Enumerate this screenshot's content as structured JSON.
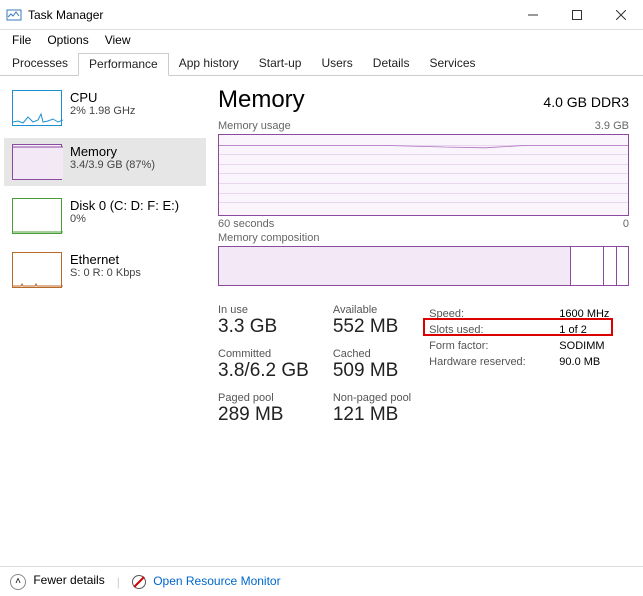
{
  "window": {
    "title": "Task Manager"
  },
  "menu": {
    "file": "File",
    "options": "Options",
    "view": "View"
  },
  "tabs": {
    "processes": "Processes",
    "performance": "Performance",
    "apphistory": "App history",
    "startup": "Start-up",
    "users": "Users",
    "details": "Details",
    "services": "Services"
  },
  "sidebar": {
    "cpu": {
      "label": "CPU",
      "sub": "2% 1.98 GHz",
      "color": "#1e90d2"
    },
    "memory": {
      "label": "Memory",
      "sub": "3.4/3.9 GB (87%)",
      "color": "#8a4a9e"
    },
    "disk": {
      "label": "Disk 0 (C: D: F: E:)",
      "sub": "0%",
      "color": "#4a9e3a"
    },
    "ethernet": {
      "label": "Ethernet",
      "sub": "S: 0 R: 0 Kbps",
      "color": "#b86a2a"
    }
  },
  "main": {
    "title": "Memory",
    "right_label": "4.0 GB DDR3",
    "usage_label": "Memory usage",
    "usage_max": "3.9 GB",
    "axis_left": "60 seconds",
    "axis_right": "0",
    "comp_label": "Memory composition"
  },
  "stats": {
    "inuse": {
      "label": "In use",
      "value": "3.3 GB"
    },
    "available": {
      "label": "Available",
      "value": "552 MB"
    },
    "committed": {
      "label": "Committed",
      "value": "3.8/6.2 GB"
    },
    "cached": {
      "label": "Cached",
      "value": "509 MB"
    },
    "paged": {
      "label": "Paged pool",
      "value": "289 MB"
    },
    "nonpaged": {
      "label": "Non-paged pool",
      "value": "121 MB"
    }
  },
  "details": {
    "speed": {
      "label": "Speed:",
      "value": "1600 MHz"
    },
    "slots": {
      "label": "Slots used:",
      "value": "1 of 2"
    },
    "form": {
      "label": "Form factor:",
      "value": "SODIMM"
    },
    "reserved": {
      "label": "Hardware reserved:",
      "value": "90.0 MB"
    }
  },
  "footer": {
    "fewer": "Fewer details",
    "rm": "Open Resource Monitor"
  },
  "chart_data": {
    "type": "line",
    "title": "Memory usage",
    "xlabel": "seconds ago",
    "ylabel": "GB",
    "ylim": [
      0,
      3.9
    ],
    "x": [
      60,
      50,
      40,
      30,
      20,
      10,
      0
    ],
    "values": [
      3.38,
      3.38,
      3.38,
      3.36,
      3.34,
      3.38,
      3.38
    ]
  }
}
